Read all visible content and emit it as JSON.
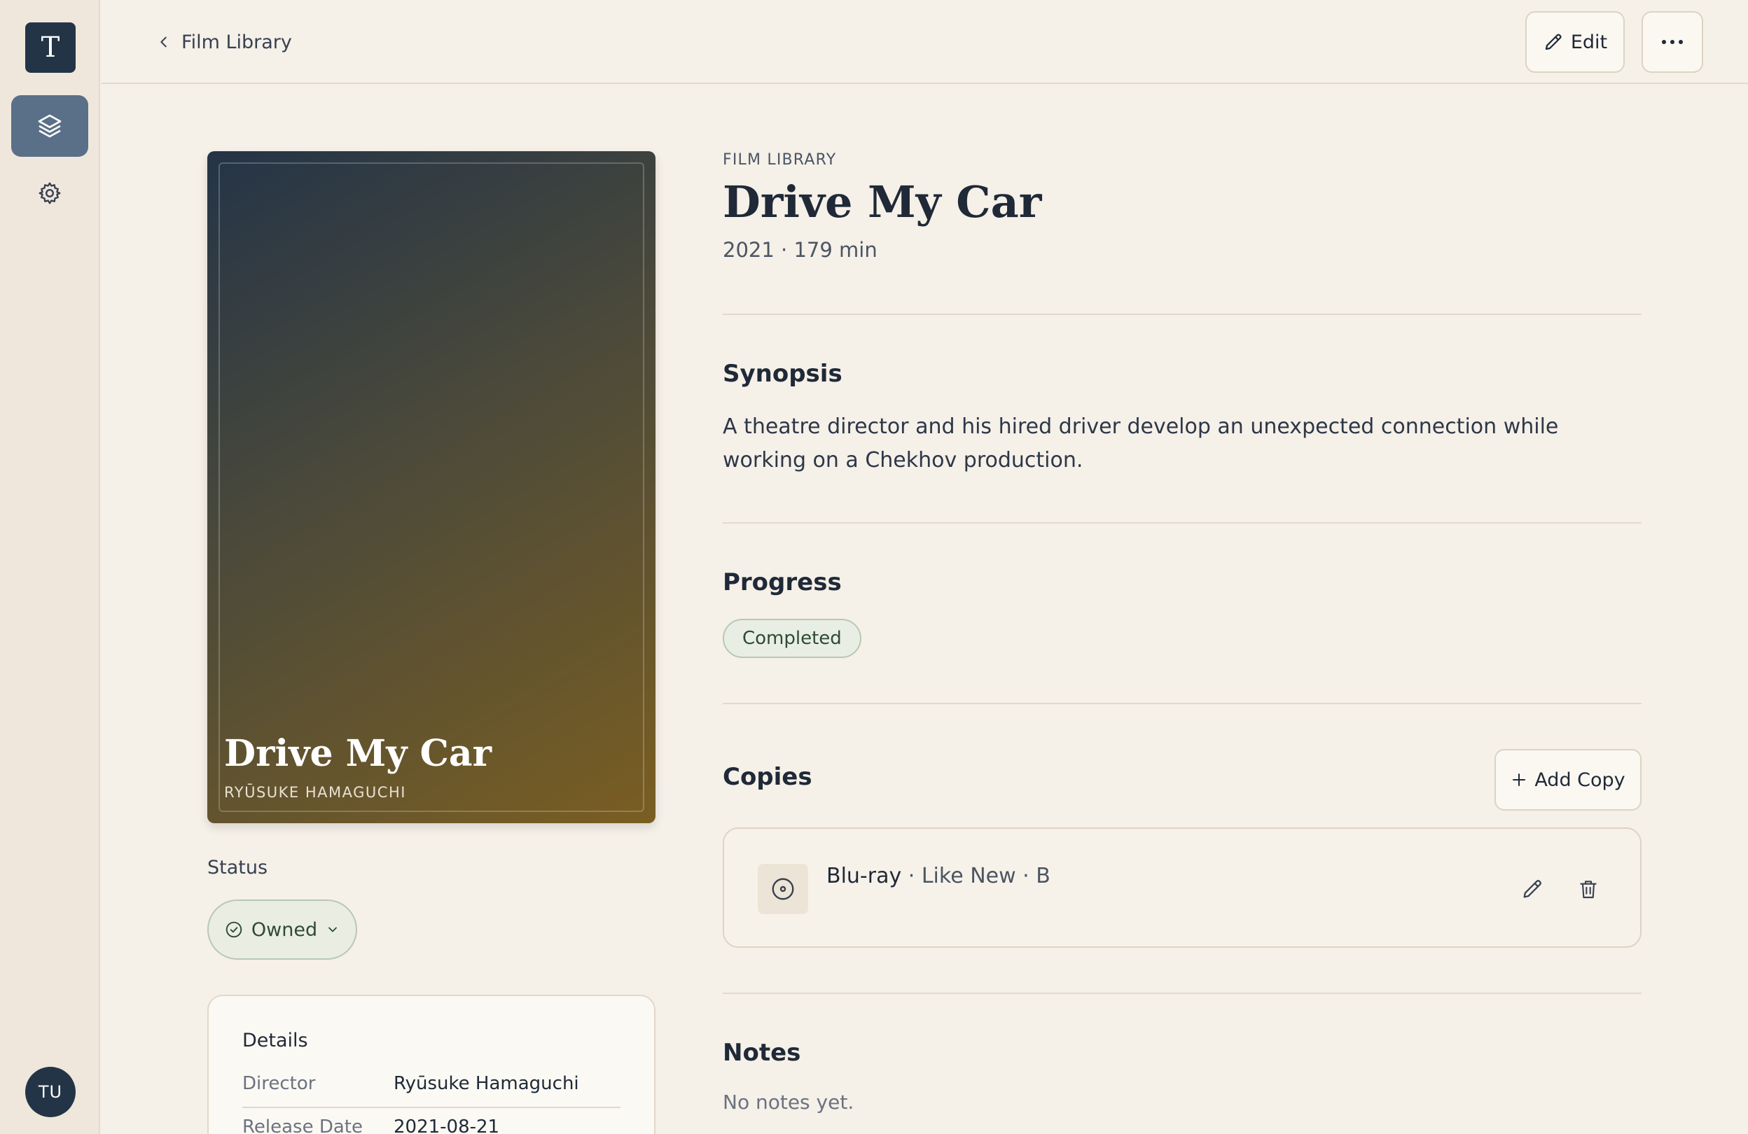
{
  "app": {
    "logo_letter": "T",
    "avatar_initials": "TU"
  },
  "sidebar": {
    "items": [
      {
        "icon": "layers-icon",
        "active": true
      },
      {
        "icon": "gear-icon",
        "active": false
      }
    ]
  },
  "header": {
    "back_label": "Film Library",
    "edit_label": "Edit",
    "more_icon": "more-horizontal-icon"
  },
  "poster": {
    "title": "Drive My Car",
    "subtitle": "RYŪSUKE HAMAGUCHI"
  },
  "status": {
    "label": "Status",
    "value": "Owned"
  },
  "details": {
    "title": "Details",
    "rows": [
      {
        "key": "Director",
        "value": "Ryūsuke Hamaguchi"
      },
      {
        "key": "Release Date",
        "value": "2021-08-21"
      }
    ]
  },
  "film": {
    "eyebrow": "FILM LIBRARY",
    "title": "Drive My Car",
    "meta": "2021 · 179 min"
  },
  "synopsis": {
    "heading": "Synopsis",
    "text": "A theatre director and his hired driver develop an unexpected connection while working on a Chekhov production."
  },
  "progress": {
    "heading": "Progress",
    "value": "Completed"
  },
  "copies": {
    "heading": "Copies",
    "add_label": "Add Copy",
    "items": [
      {
        "format": "Blu-ray",
        "details": " · Like New · B"
      }
    ]
  },
  "notes": {
    "heading": "Notes",
    "empty": "No notes yet."
  },
  "colors": {
    "accent": "#243447",
    "background": "#f5f0e8",
    "status_green": "#2f4a35"
  }
}
